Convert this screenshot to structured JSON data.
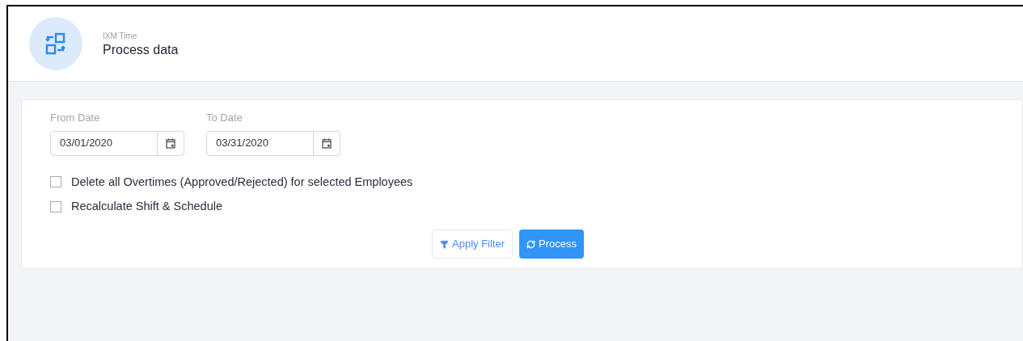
{
  "header": {
    "app": "IXM Time",
    "title": "Process data"
  },
  "dates": [
    {
      "label": "From Date",
      "value": "03/01/2020"
    },
    {
      "label": "To Date",
      "value": "03/31/2020"
    }
  ],
  "options": [
    {
      "label": "Delete all Overtimes (Approved/Rejected) for selected Employees",
      "checked": false
    },
    {
      "label": "Recalculate Shift & Schedule",
      "checked": false
    }
  ],
  "buttons": [
    {
      "kind": "secondary",
      "label": "Apply Filter"
    },
    {
      "kind": "primary",
      "label": "Process"
    }
  ]
}
